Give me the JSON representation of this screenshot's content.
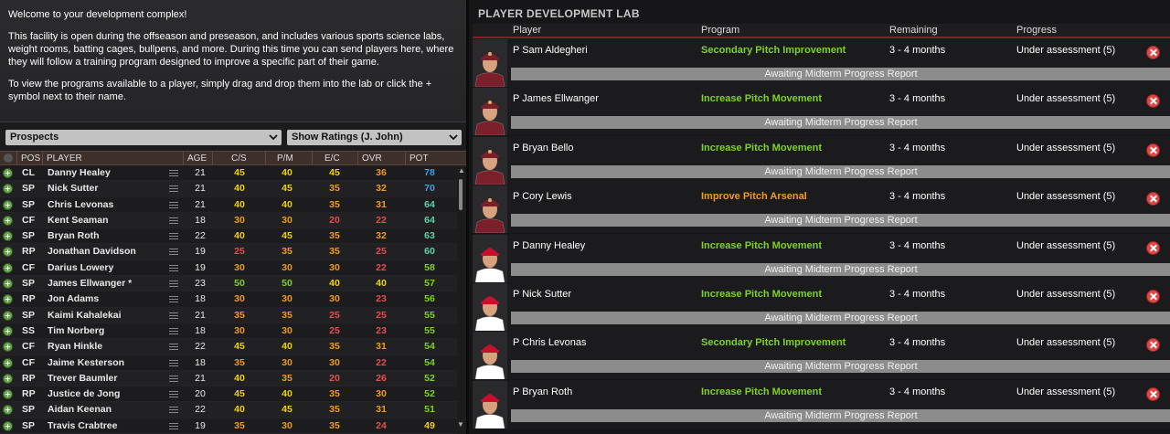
{
  "welcome": {
    "heading": "Welcome to your development complex!",
    "para1": "This facility is open during the offseason and preseason, and includes various sports science labs, weight rooms, batting cages, bullpens, and more. During this time you can send players here, where they will follow a training program designed to improve a specific part of their game.",
    "para2": "To view the programs available to a player, simply drag and drop them into the lab or click the + symbol next to their name."
  },
  "filters": {
    "prospects": "Prospects",
    "ratings": "Show Ratings (J. John)"
  },
  "table": {
    "headers": {
      "pos": "POS",
      "player": "PLAYER",
      "age": "AGE",
      "cs": "C/S",
      "pm": "P/M",
      "ec": "E/C",
      "ovr": "OVR",
      "pot": "POT"
    },
    "rows": [
      {
        "pos": "CL",
        "name": "Danny Healey",
        "age": "21",
        "cs": "45",
        "pm": "40",
        "ec": "45",
        "ovr": "36",
        "pot": "78"
      },
      {
        "pos": "SP",
        "name": "Nick Sutter",
        "age": "21",
        "cs": "40",
        "pm": "45",
        "ec": "35",
        "ovr": "32",
        "pot": "70"
      },
      {
        "pos": "SP",
        "name": "Chris Levonas",
        "age": "21",
        "cs": "40",
        "pm": "40",
        "ec": "35",
        "ovr": "31",
        "pot": "64"
      },
      {
        "pos": "CF",
        "name": "Kent Seaman",
        "age": "18",
        "cs": "30",
        "pm": "30",
        "ec": "20",
        "ovr": "22",
        "pot": "64"
      },
      {
        "pos": "SP",
        "name": "Bryan Roth",
        "age": "22",
        "cs": "40",
        "pm": "45",
        "ec": "35",
        "ovr": "32",
        "pot": "63"
      },
      {
        "pos": "RP",
        "name": "Jonathan Davidson",
        "age": "19",
        "cs": "25",
        "pm": "35",
        "ec": "35",
        "ovr": "25",
        "pot": "60"
      },
      {
        "pos": "CF",
        "name": "Darius Lowery",
        "age": "19",
        "cs": "30",
        "pm": "30",
        "ec": "30",
        "ovr": "22",
        "pot": "58"
      },
      {
        "pos": "SP",
        "name": "James Ellwanger *",
        "age": "23",
        "cs": "50",
        "pm": "50",
        "ec": "40",
        "ovr": "40",
        "pot": "57"
      },
      {
        "pos": "RP",
        "name": "Jon Adams",
        "age": "18",
        "cs": "30",
        "pm": "30",
        "ec": "30",
        "ovr": "23",
        "pot": "56"
      },
      {
        "pos": "SP",
        "name": "Kaimi Kahalekai",
        "age": "21",
        "cs": "35",
        "pm": "35",
        "ec": "25",
        "ovr": "25",
        "pot": "55"
      },
      {
        "pos": "SS",
        "name": "Tim Norberg",
        "age": "18",
        "cs": "30",
        "pm": "30",
        "ec": "25",
        "ovr": "23",
        "pot": "55"
      },
      {
        "pos": "CF",
        "name": "Ryan Hinkle",
        "age": "22",
        "cs": "45",
        "pm": "40",
        "ec": "35",
        "ovr": "31",
        "pot": "54"
      },
      {
        "pos": "CF",
        "name": "Jaime Kesterson",
        "age": "18",
        "cs": "35",
        "pm": "30",
        "ec": "30",
        "ovr": "22",
        "pot": "54"
      },
      {
        "pos": "RP",
        "name": "Trever Baumler",
        "age": "21",
        "cs": "40",
        "pm": "35",
        "ec": "20",
        "ovr": "26",
        "pot": "52"
      },
      {
        "pos": "RP",
        "name": "Justice de Jong",
        "age": "20",
        "cs": "45",
        "pm": "40",
        "ec": "35",
        "ovr": "30",
        "pot": "52"
      },
      {
        "pos": "SP",
        "name": "Aidan Keenan",
        "age": "22",
        "cs": "40",
        "pm": "45",
        "ec": "35",
        "ovr": "31",
        "pot": "51"
      },
      {
        "pos": "SP",
        "name": "Travis Crabtree",
        "age": "19",
        "cs": "35",
        "pm": "30",
        "ec": "35",
        "ovr": "24",
        "pot": "49"
      }
    ]
  },
  "lab": {
    "title": "PLAYER DEVELOPMENT LAB",
    "headers": {
      "player": "Player",
      "program": "Program",
      "remaining": "Remaining",
      "progress": "Progress"
    },
    "entries": [
      {
        "player": "P Sam Aldegheri",
        "program": "Secondary Pitch Improvement",
        "program_color": "green",
        "remaining": "3 - 4 months",
        "progress": "Under assessment (5)",
        "bar": "Awaiting Midterm Progress Report",
        "jersey": "maroon"
      },
      {
        "player": "P James Ellwanger",
        "program": "Increase Pitch Movement",
        "program_color": "green",
        "remaining": "3 - 4 months",
        "progress": "Under assessment (5)",
        "bar": "Awaiting Midterm Progress Report",
        "jersey": "maroon"
      },
      {
        "player": "P Bryan Bello",
        "program": "Increase Pitch Movement",
        "program_color": "green",
        "remaining": "3 - 4 months",
        "progress": "Under assessment (5)",
        "bar": "Awaiting Midterm Progress Report",
        "jersey": "maroon"
      },
      {
        "player": "P Cory Lewis",
        "program": "Improve Pitch Arsenal",
        "program_color": "orange",
        "remaining": "3 - 4 months",
        "progress": "Under assessment (5)",
        "bar": "Awaiting Midterm Progress Report",
        "jersey": "maroon"
      },
      {
        "player": "P Danny Healey",
        "program": "Increase Pitch Movement",
        "program_color": "green",
        "remaining": "3 - 4 months",
        "progress": "Under assessment (5)",
        "bar": "Awaiting Midterm Progress Report",
        "jersey": "red"
      },
      {
        "player": "P Nick Sutter",
        "program": "Increase Pitch Movement",
        "program_color": "green",
        "remaining": "3 - 4 months",
        "progress": "Under assessment (5)",
        "bar": "Awaiting Midterm Progress Report",
        "jersey": "red"
      },
      {
        "player": "P Chris Levonas",
        "program": "Secondary Pitch Improvement",
        "program_color": "green",
        "remaining": "3 - 4 months",
        "progress": "Under assessment (5)",
        "bar": "Awaiting Midterm Progress Report",
        "jersey": "red"
      },
      {
        "player": "P Bryan Roth",
        "program": "Increase Pitch Movement",
        "program_color": "green",
        "remaining": "3 - 4 months",
        "progress": "Under assessment (5)",
        "bar": "Awaiting Midterm Progress Report",
        "jersey": "red"
      }
    ]
  }
}
